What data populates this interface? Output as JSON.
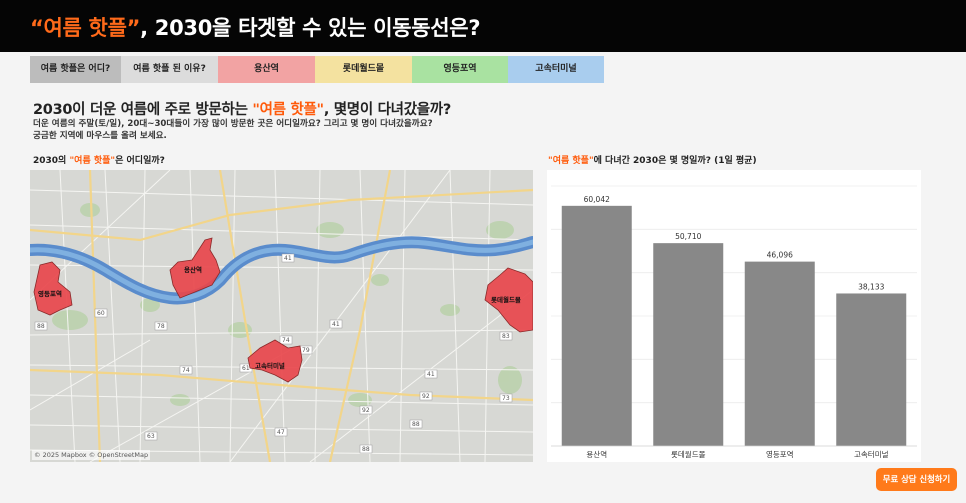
{
  "header": {
    "title_quote": "“여름 핫플”",
    "title_rest": ", 2030을 타겟할 수 있는 이동동선은?"
  },
  "tabs": [
    {
      "label": "여름 핫플은 어디?",
      "color": "#bcbcbc"
    },
    {
      "label": "여름 핫플 된 이유?",
      "color": "#dcdcdc"
    },
    {
      "label": "용산역",
      "color": "#f2a3a3"
    },
    {
      "label": "롯데월드몰",
      "color": "#f4e2a0"
    },
    {
      "label": "영등포역",
      "color": "#a9e2a1"
    },
    {
      "label": "고속터미널",
      "color": "#a9cdee"
    }
  ],
  "heading": {
    "part1": "2030이 더운 여름에 주로 방문하는 ",
    "highlight": "\"여름 핫플\"",
    "part2": ", 몇명이 다녀갔을까?"
  },
  "subtext": [
    "더운 여름의 주말(토/일), 20대~30대들이 가장 많이 방문한 곳은 어디일까요? 그리고 몇 명이 다녀갔을까요?",
    "궁금한 지역에 마우스를 올려 보세요."
  ],
  "map_panel": {
    "title_pre": "2030의 ",
    "title_hl": "\"여름 핫플\"",
    "title_post": "은 어디일까?",
    "attribution": "© 2025 Mapbox © OpenStreetMap",
    "regions": [
      "영등포역",
      "용산역",
      "고속터미널",
      "롯데월드몰"
    ],
    "region_color": "#e8474c",
    "river_color": "#5a8ccc",
    "road_labels": [
      "41",
      "60",
      "78",
      "61",
      "88",
      "41",
      "79",
      "88",
      "41",
      "73",
      "74",
      "74",
      "92",
      "92",
      "88",
      "47",
      "83",
      "63"
    ]
  },
  "chart_panel": {
    "title_hl": "\"여름 핫플\"",
    "title_post": "에 다녀간 2030은 몇 명일까? (1일 평균)"
  },
  "chart_data": {
    "type": "bar",
    "categories": [
      "용산역",
      "롯데월드몰",
      "영등포역",
      "고속터미널"
    ],
    "values": [
      60042,
      50710,
      46096,
      38133
    ],
    "value_labels": [
      "60,042",
      "50,710",
      "46,096",
      "38,133"
    ],
    "ylim": [
      0,
      65000
    ],
    "bar_color": "#888888",
    "grid": true
  },
  "cta": {
    "label": "무료 상담 신청하기"
  }
}
